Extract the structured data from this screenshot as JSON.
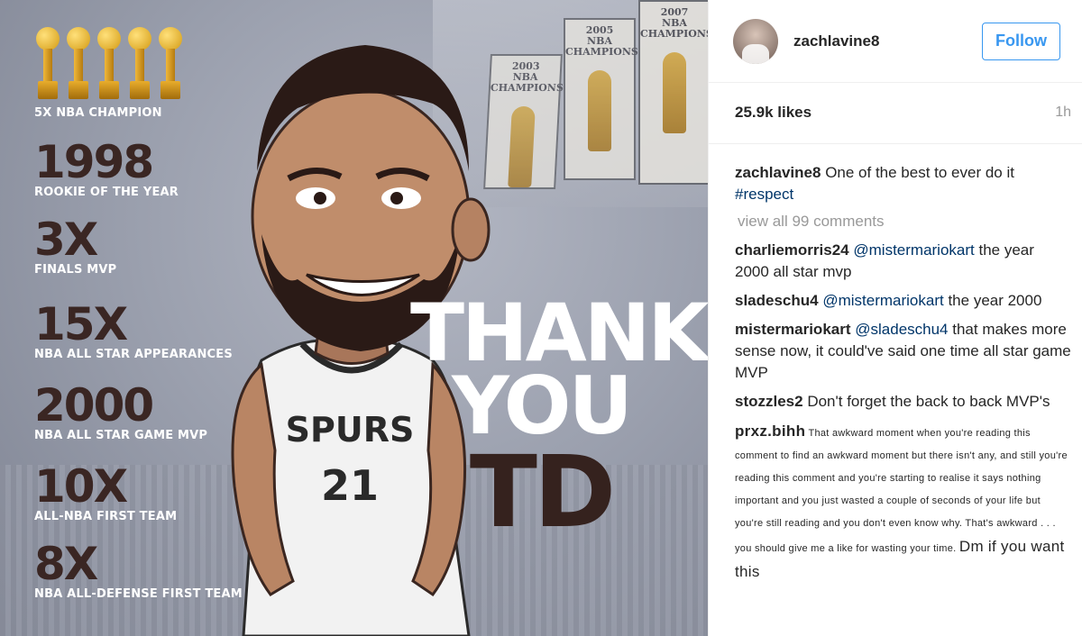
{
  "photo": {
    "stats": [
      {
        "big": "",
        "small": "5X NBA CHAMPION"
      },
      {
        "big": "1998",
        "small": "ROOKIE OF THE YEAR"
      },
      {
        "big": "3X",
        "small": "FINALS MVP"
      },
      {
        "big": "15X",
        "small": "NBA ALL STAR APPEARANCES"
      },
      {
        "big": "2000",
        "small": "NBA ALL STAR GAME MVP"
      },
      {
        "big": "10X",
        "small": "ALL-NBA FIRST TEAM"
      },
      {
        "big": "8X",
        "small": "NBA ALL-DEFENSE FIRST TEAM"
      }
    ],
    "thank_line1": "THANK",
    "thank_line2": "YOU",
    "thank_line3": "TD",
    "jersey_team": "SPURS",
    "jersey_number": "21",
    "banners": [
      {
        "year": "2003",
        "text": "NBA CHAMPIONS"
      },
      {
        "year": "2005",
        "text": "NBA CHAMPIONS"
      },
      {
        "year": "2007",
        "text": "NBA CHAMPIONS"
      }
    ]
  },
  "header": {
    "username": "zachlavine8",
    "follow_label": "Follow"
  },
  "stats": {
    "likes": "25.9k likes",
    "time": "1h"
  },
  "caption": {
    "user": "zachlavine8",
    "text": "One of the best to ever do it",
    "hashtag": "#respect"
  },
  "view_all": "view all 99 comments",
  "comments": [
    {
      "user": "charliemorris24",
      "mention": "@mistermariokart",
      "text": " the year 2000 all star mvp"
    },
    {
      "user": "sladeschu4",
      "mention": "@mistermariokart",
      "text": " the year 2000"
    },
    {
      "user": "mistermariokart",
      "mention": "@sladeschu4",
      "text": " that makes more sense now, it could've said one time all star game MVP"
    },
    {
      "user": "stozzles2",
      "mention": "",
      "text": "Don't forget the back to back MVP's"
    }
  ],
  "spam_comment": {
    "user": "prxz.bihh",
    "small_text": "That awkward moment when you're reading this comment to find an awkward moment but there isn't any, and still you're reading this comment and you're starting to realise it says nothing important and you just wasted a couple of seconds of your life but you're still reading and you don't even know why. That's awkward . . . you should give me a like for wasting your time.",
    "tail": "Dm if you want this"
  },
  "colors": {
    "accent": "#3897f0",
    "hashtag": "#003569",
    "muted": "#999999"
  }
}
